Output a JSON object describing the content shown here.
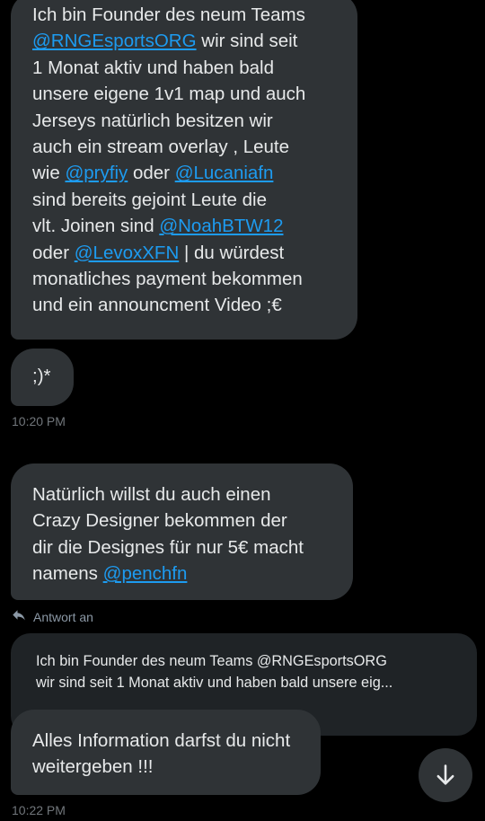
{
  "messages": [
    {
      "lines": [
        {
          "parts": [
            {
              "text": "Ich bin Founder des neum Teams"
            }
          ]
        },
        {
          "parts": [
            {
              "text": "@RNGEsportsORG",
              "mention": true
            },
            {
              "text": " wir sind seit"
            }
          ]
        },
        {
          "parts": [
            {
              "text": "1 Monat aktiv und haben bald"
            }
          ]
        },
        {
          "parts": [
            {
              "text": "unsere eigene 1v1 map und auch"
            }
          ]
        },
        {
          "parts": [
            {
              "text": "Jerseys natürlich besitzen wir"
            }
          ]
        },
        {
          "parts": [
            {
              "text": "auch ein stream overlay , Leute"
            }
          ]
        },
        {
          "parts": [
            {
              "text": "wie "
            },
            {
              "text": "@pryfiy",
              "mention": true
            },
            {
              "text": " oder "
            },
            {
              "text": "@Lucaniafn",
              "mention": true
            }
          ]
        },
        {
          "parts": [
            {
              "text": "sind bereits gejoint Leute die"
            }
          ]
        },
        {
          "parts": [
            {
              "text": "vlt. Joinen sind "
            },
            {
              "text": "@NoahBTW12",
              "mention": true
            }
          ]
        },
        {
          "parts": [
            {
              "text": "oder "
            },
            {
              "text": "@LevoxXFN",
              "mention": true
            },
            {
              "text": " | du würdest"
            }
          ]
        },
        {
          "parts": [
            {
              "text": "monatliches payment bekommen"
            }
          ]
        },
        {
          "parts": [
            {
              "text": "und ein announcment Video ;€"
            }
          ]
        }
      ]
    },
    {
      "lines": [
        {
          "parts": [
            {
              "text": ";)*"
            }
          ]
        }
      ],
      "timestamp": "10:20 PM"
    },
    {
      "lines": [
        {
          "parts": [
            {
              "text": "Natürlich willst du auch einen"
            }
          ]
        },
        {
          "parts": [
            {
              "text": "Crazy Designer bekommen der"
            }
          ]
        },
        {
          "parts": [
            {
              "text": "dir die Designes für nur 5€ macht"
            }
          ]
        },
        {
          "parts": [
            {
              "text": "namens "
            },
            {
              "text": "@penchfn",
              "mention": true
            }
          ]
        }
      ]
    },
    {
      "lines": [
        {
          "parts": [
            {
              "text": "Alles Information darfst du nicht"
            }
          ]
        },
        {
          "parts": [
            {
              "text": "weitergeben !!!"
            }
          ]
        }
      ],
      "timestamp": "10:22 PM"
    }
  ],
  "reply": {
    "label": "Antwort an",
    "quote_line1": "Ich bin Founder des neum Teams @RNGEsportsORG",
    "quote_line2": "wir sind seit 1 Monat aktiv und haben bald unsere eig..."
  },
  "icons": {
    "reply": "reply-arrow-icon",
    "scroll": "arrow-down-icon"
  },
  "colors": {
    "background": "#000000",
    "bubble": "#2f3336",
    "mention": "#1d9bf0",
    "timestamp": "#71767b"
  }
}
